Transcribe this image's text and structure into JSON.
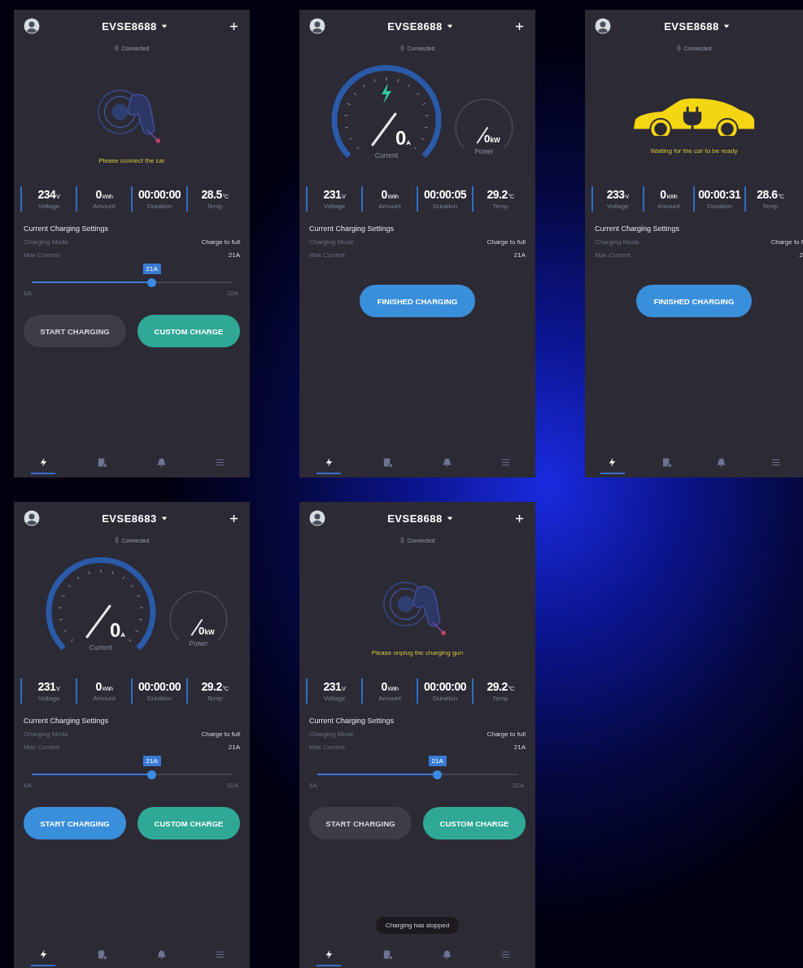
{
  "screens": [
    {
      "title": "EVSE8688",
      "add_button": true,
      "status": "Connected",
      "hero": {
        "kind": "plug",
        "message": "Please connect the car"
      },
      "stats": [
        {
          "value": "234",
          "unit": "V",
          "label": "Voltage"
        },
        {
          "value": "0",
          "unit": "kWh",
          "label": "Amount"
        },
        {
          "value": "00:00:00",
          "label": "Duration"
        },
        {
          "value": "28.5",
          "unit": "°C",
          "label": "Temp"
        }
      ],
      "settings_title": "Current Charging Settings",
      "settings": [
        {
          "label": "Charging Mode",
          "value": "Charge to full"
        },
        {
          "label": "Max Current",
          "value": "21A"
        }
      ],
      "slider": {
        "level": 0.6,
        "bubble": "21A",
        "min": "6A",
        "max": "32A"
      },
      "buttons": [
        {
          "label": "START CHARGING",
          "kind": "muted"
        },
        {
          "label": "CUSTOM CHARGE",
          "kind": "teal"
        }
      ],
      "nav": [
        {
          "selected": true
        },
        {
          "selected": false
        },
        {
          "selected": false
        },
        {
          "selected": false
        }
      ]
    },
    {
      "title": "EVSE8688",
      "add_button": true,
      "status": "Connected",
      "hero": {
        "kind": "gauges",
        "charging": true,
        "current": "0",
        "current_unit": "A",
        "current_label": "Current",
        "power": "0",
        "power_unit": "kW",
        "power_label": "Power"
      },
      "stats": [
        {
          "value": "231",
          "unit": "V",
          "label": "Voltage"
        },
        {
          "value": "0",
          "unit": "kWh",
          "label": "Amount"
        },
        {
          "value": "00:00:05",
          "label": "Duration"
        },
        {
          "value": "29.2",
          "unit": "°C",
          "label": "Temp"
        }
      ],
      "settings_title": "Current Charging Settings",
      "settings": [
        {
          "label": "Charging Mode",
          "value": "Charge to full"
        },
        {
          "label": "Max Current",
          "value": "21A"
        }
      ],
      "buttons": [
        {
          "label": "FINISHED CHARGING",
          "kind": "primary"
        }
      ],
      "nav": [
        {
          "selected": true
        },
        {
          "selected": false
        },
        {
          "selected": false
        },
        {
          "selected": false
        }
      ]
    },
    {
      "title": "EVSE8688",
      "add_button": false,
      "status": "Connected",
      "hero": {
        "kind": "car",
        "message": "Waiting for the car to be ready"
      },
      "stats": [
        {
          "value": "233",
          "unit": "V",
          "label": "Voltage"
        },
        {
          "value": "0",
          "unit": "kWh",
          "label": "Amount"
        },
        {
          "value": "00:00:31",
          "label": "Duration"
        },
        {
          "value": "28.6",
          "unit": "°C",
          "label": "Temp"
        }
      ],
      "settings_title": "Current Charging Settings",
      "settings": [
        {
          "label": "Charging Mode",
          "value": "Charge to f"
        },
        {
          "label": "Max Current",
          "value": "2"
        }
      ],
      "buttons": [
        {
          "label": "FINISHED CHARGING",
          "kind": "primary"
        }
      ],
      "nav": [
        {
          "selected": true
        },
        {
          "selected": false
        },
        {
          "selected": false
        },
        {
          "selected": false
        }
      ]
    },
    {
      "title": "EVSE8683",
      "add_button": true,
      "status": "Connected",
      "hero": {
        "kind": "gauges",
        "charging": false,
        "current": "0",
        "current_unit": "A",
        "current_label": "Current",
        "power": "0",
        "power_unit": "kW",
        "power_label": "Power"
      },
      "stats": [
        {
          "value": "231",
          "unit": "V",
          "label": "Voltage"
        },
        {
          "value": "0",
          "unit": "kWh",
          "label": "Amount"
        },
        {
          "value": "00:00:00",
          "label": "Duration"
        },
        {
          "value": "29.2",
          "unit": "°C",
          "label": "Temp"
        }
      ],
      "settings_title": "Current Charging Settings",
      "settings": [
        {
          "label": "Charging Mode",
          "value": "Charge to full"
        },
        {
          "label": "Max Current",
          "value": "21A"
        }
      ],
      "slider": {
        "level": 0.6,
        "bubble": "21A",
        "min": "6A",
        "max": "32A"
      },
      "buttons": [
        {
          "label": "START CHARGING",
          "kind": "primary"
        },
        {
          "label": "CUSTOM CHARGE",
          "kind": "teal"
        }
      ],
      "nav": [
        {
          "selected": true
        },
        {
          "selected": false
        },
        {
          "selected": false
        },
        {
          "selected": false
        }
      ]
    },
    {
      "title": "EVSE8688",
      "add_button": true,
      "status": "Connected",
      "hero": {
        "kind": "plug",
        "message": "Please unplug the charging gun"
      },
      "stats": [
        {
          "value": "231",
          "unit": "V",
          "label": "Voltage"
        },
        {
          "value": "0",
          "unit": "kWh",
          "label": "Amount"
        },
        {
          "value": "00:00:00",
          "label": "Duration"
        },
        {
          "value": "29.2",
          "unit": "°C",
          "label": "Temp"
        }
      ],
      "settings_title": "Current Charging Settings",
      "settings": [
        {
          "label": "Charging Mode",
          "value": "Charge to full"
        },
        {
          "label": "Max Current",
          "value": "21A"
        }
      ],
      "slider": {
        "level": 0.6,
        "bubble": "21A",
        "min": "6A",
        "max": "32A"
      },
      "buttons": [
        {
          "label": "START CHARGING",
          "kind": "muted"
        },
        {
          "label": "CUSTOM CHARGE",
          "kind": "teal"
        }
      ],
      "toast": "Charging has stopped",
      "nav": [
        {
          "selected": true
        },
        {
          "selected": false
        },
        {
          "selected": false
        },
        {
          "selected": false
        }
      ]
    }
  ]
}
